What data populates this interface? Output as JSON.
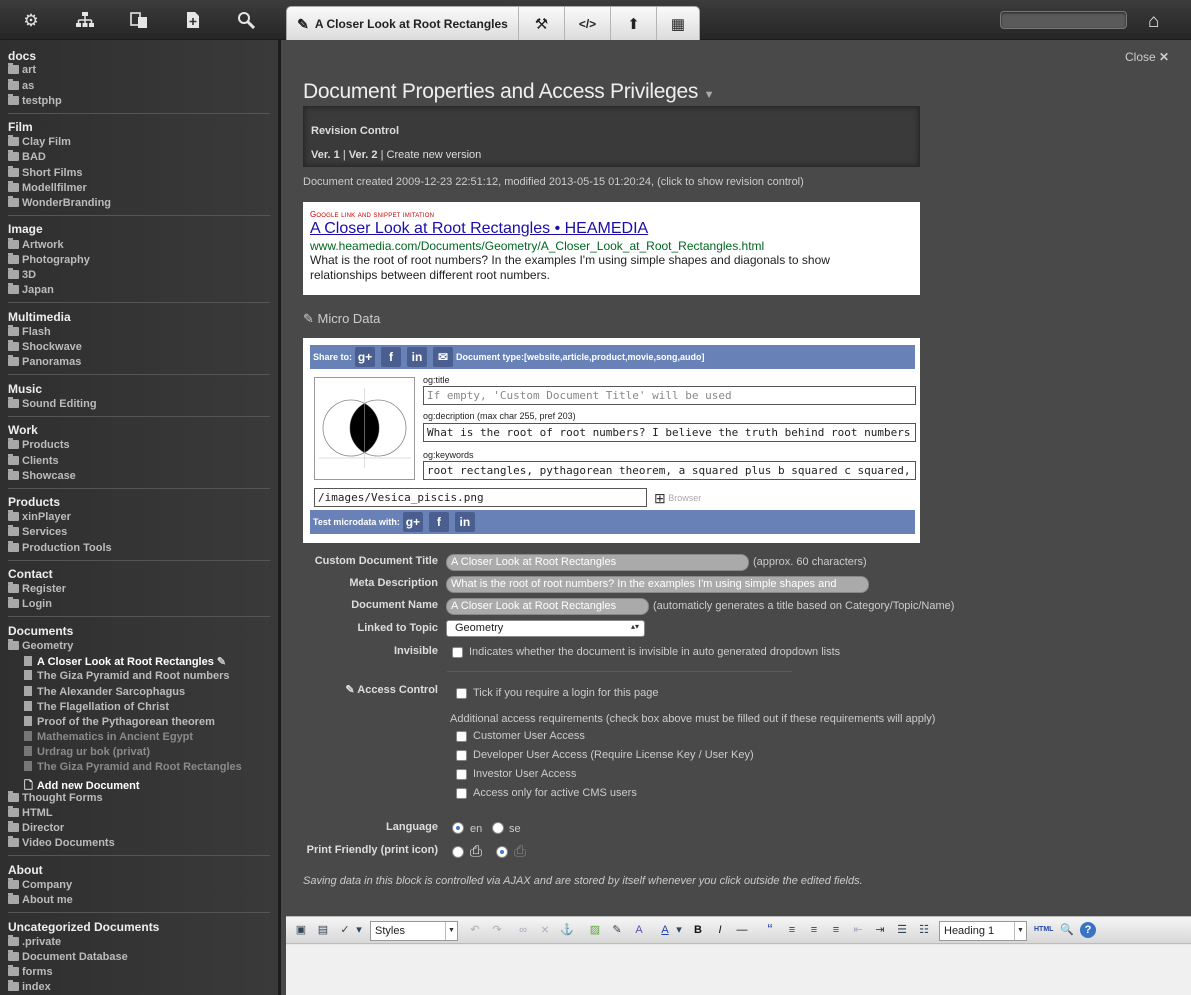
{
  "topbar": {
    "tab_title": "A Closer Look at Root Rectangles",
    "search_placeholder": ""
  },
  "sidebar": {
    "groups": [
      {
        "title": "docs",
        "items": [
          "art",
          "as",
          "testphp"
        ]
      },
      {
        "title": "Film",
        "items": [
          "Clay Film",
          "BAD",
          "Short Films",
          "Modellfilmer",
          "WonderBranding"
        ]
      },
      {
        "title": "Image",
        "items": [
          "Artwork",
          "Photography",
          "3D",
          "Japan"
        ]
      },
      {
        "title": "Multimedia",
        "items": [
          "Flash",
          "Shockwave",
          "Panoramas"
        ]
      },
      {
        "title": "Music",
        "items": [
          "Sound Editing"
        ]
      },
      {
        "title": "Work",
        "items": [
          "Products",
          "Clients",
          "Showcase"
        ]
      },
      {
        "title": "Products",
        "items": [
          "xinPlayer",
          "Services",
          "Production Tools"
        ]
      },
      {
        "title": "Contact",
        "items": [
          "Register",
          "Login"
        ]
      },
      {
        "title": "Documents",
        "items": [
          "Geometry"
        ]
      },
      {
        "title": "About",
        "items": [
          "Company",
          "About me"
        ]
      },
      {
        "title": "Uncategorized Documents",
        "items": [
          ".private",
          "Document Database",
          "forms",
          "index"
        ]
      }
    ],
    "geometry_docs": [
      "A Closer Look at Root Rectangles",
      "The Giza Pyramid and Root numbers",
      "The Alexander Sarcophagus",
      "The Flagellation of Christ",
      "Proof of the Pythagorean theorem",
      "Mathematics in Ancient Egypt",
      "Urdrag ur bok (privat)",
      "The Giza Pyramid and Root Rectangles"
    ],
    "add_new": "Add new Document",
    "documents_more": [
      "Thought Forms",
      "HTML",
      "Director",
      "Video Documents"
    ]
  },
  "main": {
    "close_label": "Close",
    "heading": "Document Properties and Access Privileges",
    "revision": {
      "title": "Revision Control",
      "ver1": "Ver. 1",
      "ver2": "Ver. 2",
      "create": "Create new version"
    },
    "created_text": "Document created 2009-12-23 22:51:12, modified 2013-05-15 01:20:24, (click to show revision control)",
    "snippet": {
      "label": "Google link and snippet imitation",
      "title": "A Closer Look at Root Rectangles • HEAMEDIA",
      "url": "www.heamedia.com/Documents/Geometry/A_Closer_Look_at_Root_Rectangles.html",
      "desc": "What is the root of root numbers? In the examples I'm using simple shapes and diagonals to show relationships between different root numbers."
    },
    "micro_label": "Micro Data",
    "microdata": {
      "share_to": "Share to:",
      "doc_type": "Document type:[website,article,product,movie,song,audo]",
      "og_title_label": "og:title",
      "og_title_placeholder": "If empty, 'Custom Document Title' will be used",
      "og_desc_label": "og:decription (max char 255, pref 203)",
      "og_desc_value": "What is the root of root numbers? I believe the truth behind root numbers is quite simple, t",
      "og_kw_label": "og:keywords",
      "og_kw_value": "root rectangles, pythagorean theorem, a squared plus b squared c squared, extreme mean",
      "image_path": "/images/Vesica_piscis.png",
      "browser": "Browser",
      "test_with": "Test microdata with:"
    },
    "fields": {
      "custom_title_label": "Custom Document Title",
      "custom_title_value": "A Closer Look at Root Rectangles",
      "custom_title_note": "(approx. 60 characters)",
      "meta_desc_label": "Meta Description",
      "meta_desc_value": "What is the root of root numbers? In the examples I'm using simple shapes and",
      "doc_name_label": "Document Name",
      "doc_name_value": "A Closer Look at Root Rectangles",
      "doc_name_note": "(automaticly generates a title based on Category/Topic/Name)",
      "topic_label": "Linked to Topic",
      "topic_value": "Geometry",
      "invisible_label": "Invisible",
      "invisible_note": "Indicates whether the document is invisible in auto generated dropdown lists",
      "access_label": "Access Control",
      "access_login": "Tick if you require a login for this page",
      "access_additional": "Additional access requirements (check box above must be filled out if these requirements will apply)",
      "access_customer": "Customer User Access",
      "access_developer": "Developer User Access (Require License Key / User Key)",
      "access_investor": "Investor User Access",
      "access_active": "Access only for active CMS users",
      "language_label": "Language",
      "lang_en": "en",
      "lang_se": "se",
      "print_label": "Print Friendly (print icon)",
      "ajax_note": "Saving data in this block is controlled via AJAX and are stored by itself whenever you click outside the edited fields."
    }
  },
  "editor": {
    "styles": "Styles",
    "format": "Heading 1"
  }
}
